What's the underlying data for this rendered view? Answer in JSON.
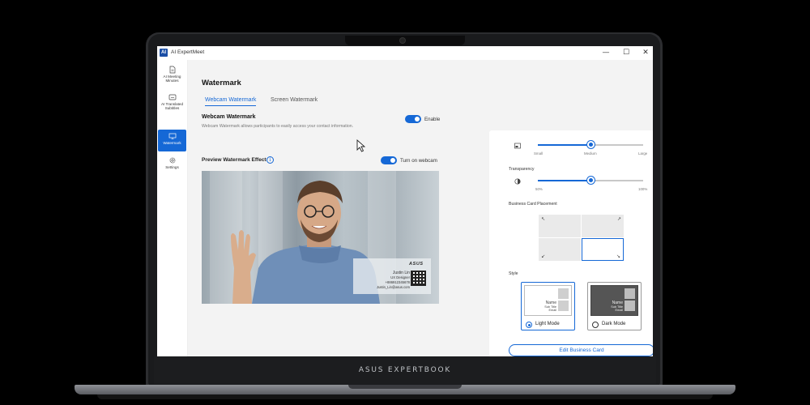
{
  "laptop": {
    "brand": "ASUS EXPERTBOOK"
  },
  "window": {
    "icon_text": "AI",
    "title": "AI ExpertMeet",
    "controls": {
      "minimize": "—",
      "maximize": "☐",
      "close": "✕"
    }
  },
  "sidebar": {
    "items": [
      {
        "label": "AI Meeting Minutes",
        "icon": "document-icon",
        "active": false
      },
      {
        "label": "AI Translated Subtitles",
        "icon": "subtitle-icon",
        "active": false
      },
      {
        "label": "Watermark",
        "icon": "monitor-icon",
        "active": true
      },
      {
        "label": "Settings",
        "icon": "gear-icon",
        "active": false
      }
    ]
  },
  "main": {
    "title": "Watermark",
    "tabs": [
      {
        "label": "Webcam Watermark",
        "active": true
      },
      {
        "label": "Screen Watermark",
        "active": false
      }
    ],
    "webcam_watermark": {
      "title": "Webcam Watermark",
      "description": "Webcam Watermark allows participants to easily access your contact information.",
      "toggle_label": "Enable",
      "enabled": true
    },
    "preview": {
      "title": "Preview Watermark Effect",
      "info_icon": "i",
      "toggle_label": "Turn on webcam",
      "webcam_on": true,
      "card": {
        "logo": "ASUS",
        "name": "Justin Lin",
        "role": "UX Designer",
        "phone": "+886912345678",
        "email": "Justin_Lin@asus.com"
      }
    }
  },
  "panel": {
    "size": {
      "icon": "image-size-icon",
      "ticks": [
        "Small",
        "Medium",
        "Large"
      ],
      "value": 0.5
    },
    "transparency": {
      "label": "Transparency",
      "icon": "contrast-icon",
      "ticks": [
        "50%",
        "100%"
      ],
      "value": 0.5
    },
    "placement": {
      "label": "Business Card Placement",
      "cells": [
        {
          "arrow": "↖",
          "selected": false
        },
        {
          "arrow": "↗",
          "selected": false
        },
        {
          "arrow": "↙",
          "selected": false
        },
        {
          "arrow": "↘",
          "selected": true
        }
      ]
    },
    "style": {
      "label": "Style",
      "options": [
        {
          "label": "Light Mode",
          "selected": true,
          "name": "Name",
          "sub_title": "Sub Title",
          "email": "Email"
        },
        {
          "label": "Dark Mode",
          "selected": false,
          "name": "Name",
          "sub_title": "Sub Title",
          "email": "Email"
        }
      ]
    },
    "edit_button": "Edit Business Card"
  },
  "colors": {
    "accent": "#1568d6",
    "window_bg": "#f3f3f3"
  }
}
